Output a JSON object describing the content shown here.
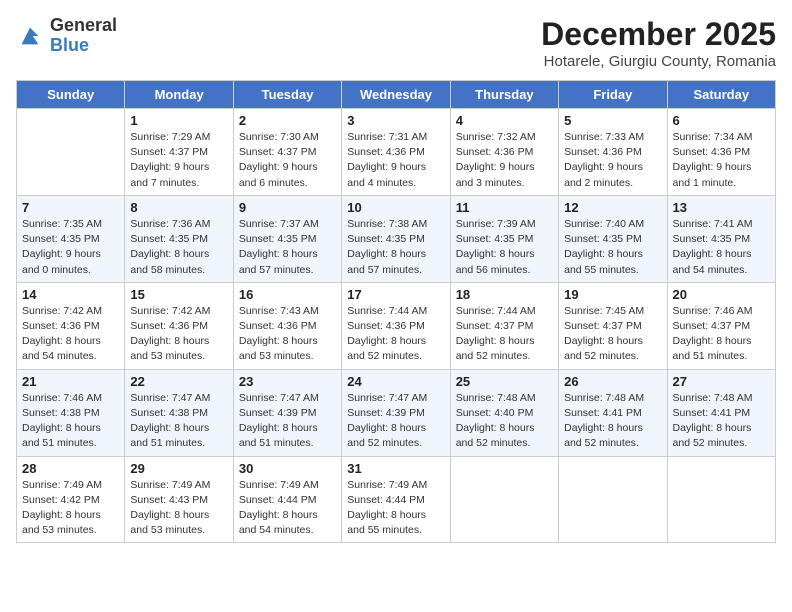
{
  "header": {
    "logo_general": "General",
    "logo_blue": "Blue",
    "month_title": "December 2025",
    "location": "Hotarele, Giurgiu County, Romania"
  },
  "weekdays": [
    "Sunday",
    "Monday",
    "Tuesday",
    "Wednesday",
    "Thursday",
    "Friday",
    "Saturday"
  ],
  "weeks": [
    [
      {
        "day": "",
        "info": ""
      },
      {
        "day": "1",
        "info": "Sunrise: 7:29 AM\nSunset: 4:37 PM\nDaylight: 9 hours\nand 7 minutes."
      },
      {
        "day": "2",
        "info": "Sunrise: 7:30 AM\nSunset: 4:37 PM\nDaylight: 9 hours\nand 6 minutes."
      },
      {
        "day": "3",
        "info": "Sunrise: 7:31 AM\nSunset: 4:36 PM\nDaylight: 9 hours\nand 4 minutes."
      },
      {
        "day": "4",
        "info": "Sunrise: 7:32 AM\nSunset: 4:36 PM\nDaylight: 9 hours\nand 3 minutes."
      },
      {
        "day": "5",
        "info": "Sunrise: 7:33 AM\nSunset: 4:36 PM\nDaylight: 9 hours\nand 2 minutes."
      },
      {
        "day": "6",
        "info": "Sunrise: 7:34 AM\nSunset: 4:36 PM\nDaylight: 9 hours\nand 1 minute."
      }
    ],
    [
      {
        "day": "7",
        "info": "Sunrise: 7:35 AM\nSunset: 4:35 PM\nDaylight: 9 hours\nand 0 minutes."
      },
      {
        "day": "8",
        "info": "Sunrise: 7:36 AM\nSunset: 4:35 PM\nDaylight: 8 hours\nand 58 minutes."
      },
      {
        "day": "9",
        "info": "Sunrise: 7:37 AM\nSunset: 4:35 PM\nDaylight: 8 hours\nand 57 minutes."
      },
      {
        "day": "10",
        "info": "Sunrise: 7:38 AM\nSunset: 4:35 PM\nDaylight: 8 hours\nand 57 minutes."
      },
      {
        "day": "11",
        "info": "Sunrise: 7:39 AM\nSunset: 4:35 PM\nDaylight: 8 hours\nand 56 minutes."
      },
      {
        "day": "12",
        "info": "Sunrise: 7:40 AM\nSunset: 4:35 PM\nDaylight: 8 hours\nand 55 minutes."
      },
      {
        "day": "13",
        "info": "Sunrise: 7:41 AM\nSunset: 4:35 PM\nDaylight: 8 hours\nand 54 minutes."
      }
    ],
    [
      {
        "day": "14",
        "info": "Sunrise: 7:42 AM\nSunset: 4:36 PM\nDaylight: 8 hours\nand 54 minutes."
      },
      {
        "day": "15",
        "info": "Sunrise: 7:42 AM\nSunset: 4:36 PM\nDaylight: 8 hours\nand 53 minutes."
      },
      {
        "day": "16",
        "info": "Sunrise: 7:43 AM\nSunset: 4:36 PM\nDaylight: 8 hours\nand 53 minutes."
      },
      {
        "day": "17",
        "info": "Sunrise: 7:44 AM\nSunset: 4:36 PM\nDaylight: 8 hours\nand 52 minutes."
      },
      {
        "day": "18",
        "info": "Sunrise: 7:44 AM\nSunset: 4:37 PM\nDaylight: 8 hours\nand 52 minutes."
      },
      {
        "day": "19",
        "info": "Sunrise: 7:45 AM\nSunset: 4:37 PM\nDaylight: 8 hours\nand 52 minutes."
      },
      {
        "day": "20",
        "info": "Sunrise: 7:46 AM\nSunset: 4:37 PM\nDaylight: 8 hours\nand 51 minutes."
      }
    ],
    [
      {
        "day": "21",
        "info": "Sunrise: 7:46 AM\nSunset: 4:38 PM\nDaylight: 8 hours\nand 51 minutes."
      },
      {
        "day": "22",
        "info": "Sunrise: 7:47 AM\nSunset: 4:38 PM\nDaylight: 8 hours\nand 51 minutes."
      },
      {
        "day": "23",
        "info": "Sunrise: 7:47 AM\nSunset: 4:39 PM\nDaylight: 8 hours\nand 51 minutes."
      },
      {
        "day": "24",
        "info": "Sunrise: 7:47 AM\nSunset: 4:39 PM\nDaylight: 8 hours\nand 52 minutes."
      },
      {
        "day": "25",
        "info": "Sunrise: 7:48 AM\nSunset: 4:40 PM\nDaylight: 8 hours\nand 52 minutes."
      },
      {
        "day": "26",
        "info": "Sunrise: 7:48 AM\nSunset: 4:41 PM\nDaylight: 8 hours\nand 52 minutes."
      },
      {
        "day": "27",
        "info": "Sunrise: 7:48 AM\nSunset: 4:41 PM\nDaylight: 8 hours\nand 52 minutes."
      }
    ],
    [
      {
        "day": "28",
        "info": "Sunrise: 7:49 AM\nSunset: 4:42 PM\nDaylight: 8 hours\nand 53 minutes."
      },
      {
        "day": "29",
        "info": "Sunrise: 7:49 AM\nSunset: 4:43 PM\nDaylight: 8 hours\nand 53 minutes."
      },
      {
        "day": "30",
        "info": "Sunrise: 7:49 AM\nSunset: 4:44 PM\nDaylight: 8 hours\nand 54 minutes."
      },
      {
        "day": "31",
        "info": "Sunrise: 7:49 AM\nSunset: 4:44 PM\nDaylight: 8 hours\nand 55 minutes."
      },
      {
        "day": "",
        "info": ""
      },
      {
        "day": "",
        "info": ""
      },
      {
        "day": "",
        "info": ""
      }
    ]
  ]
}
